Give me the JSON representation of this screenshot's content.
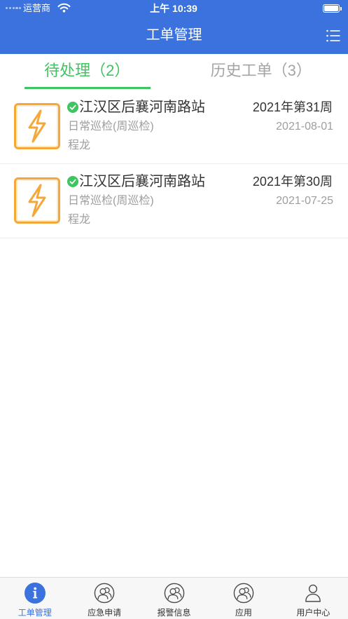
{
  "status_bar": {
    "carrier": "运营商",
    "time": "上午 10:39",
    "battery_fraction": 1.0,
    "wifi_icon": "wifi-icon",
    "battery_icon": "battery-icon"
  },
  "header": {
    "title": "工单管理",
    "menu_icon": "list-menu-icon"
  },
  "tabs": [
    {
      "label": "待处理（2）",
      "active": true
    },
    {
      "label": "历史工单（3）",
      "active": false
    }
  ],
  "orders": [
    {
      "type_icon": "lightning-icon",
      "status_icon": "check-circle-icon",
      "station": "江汉区后襄河南路站",
      "week": "2021年第31周",
      "type": "日常巡检(周巡检)",
      "date": "2021-08-01",
      "person": "程龙"
    },
    {
      "type_icon": "lightning-icon",
      "status_icon": "check-circle-icon",
      "station": "江汉区后襄河南路站",
      "week": "2021年第30周",
      "type": "日常巡检(周巡检)",
      "date": "2021-07-25",
      "person": "程龙"
    }
  ],
  "bottom_nav": [
    {
      "label": "工单管理",
      "icon": "info-icon",
      "active": true
    },
    {
      "label": "应急申请",
      "icon": "group-icon",
      "active": false
    },
    {
      "label": "报警信息",
      "icon": "group-icon",
      "active": false
    },
    {
      "label": "应用",
      "icon": "group-icon",
      "active": false
    },
    {
      "label": "用户中心",
      "icon": "user-icon",
      "active": false
    }
  ],
  "colors": {
    "primary": "#3b72dd",
    "accent_green": "#3ec55f",
    "icon_orange": "#f5a83a",
    "text_dark": "#333333",
    "text_gray": "#9e9e9e"
  }
}
